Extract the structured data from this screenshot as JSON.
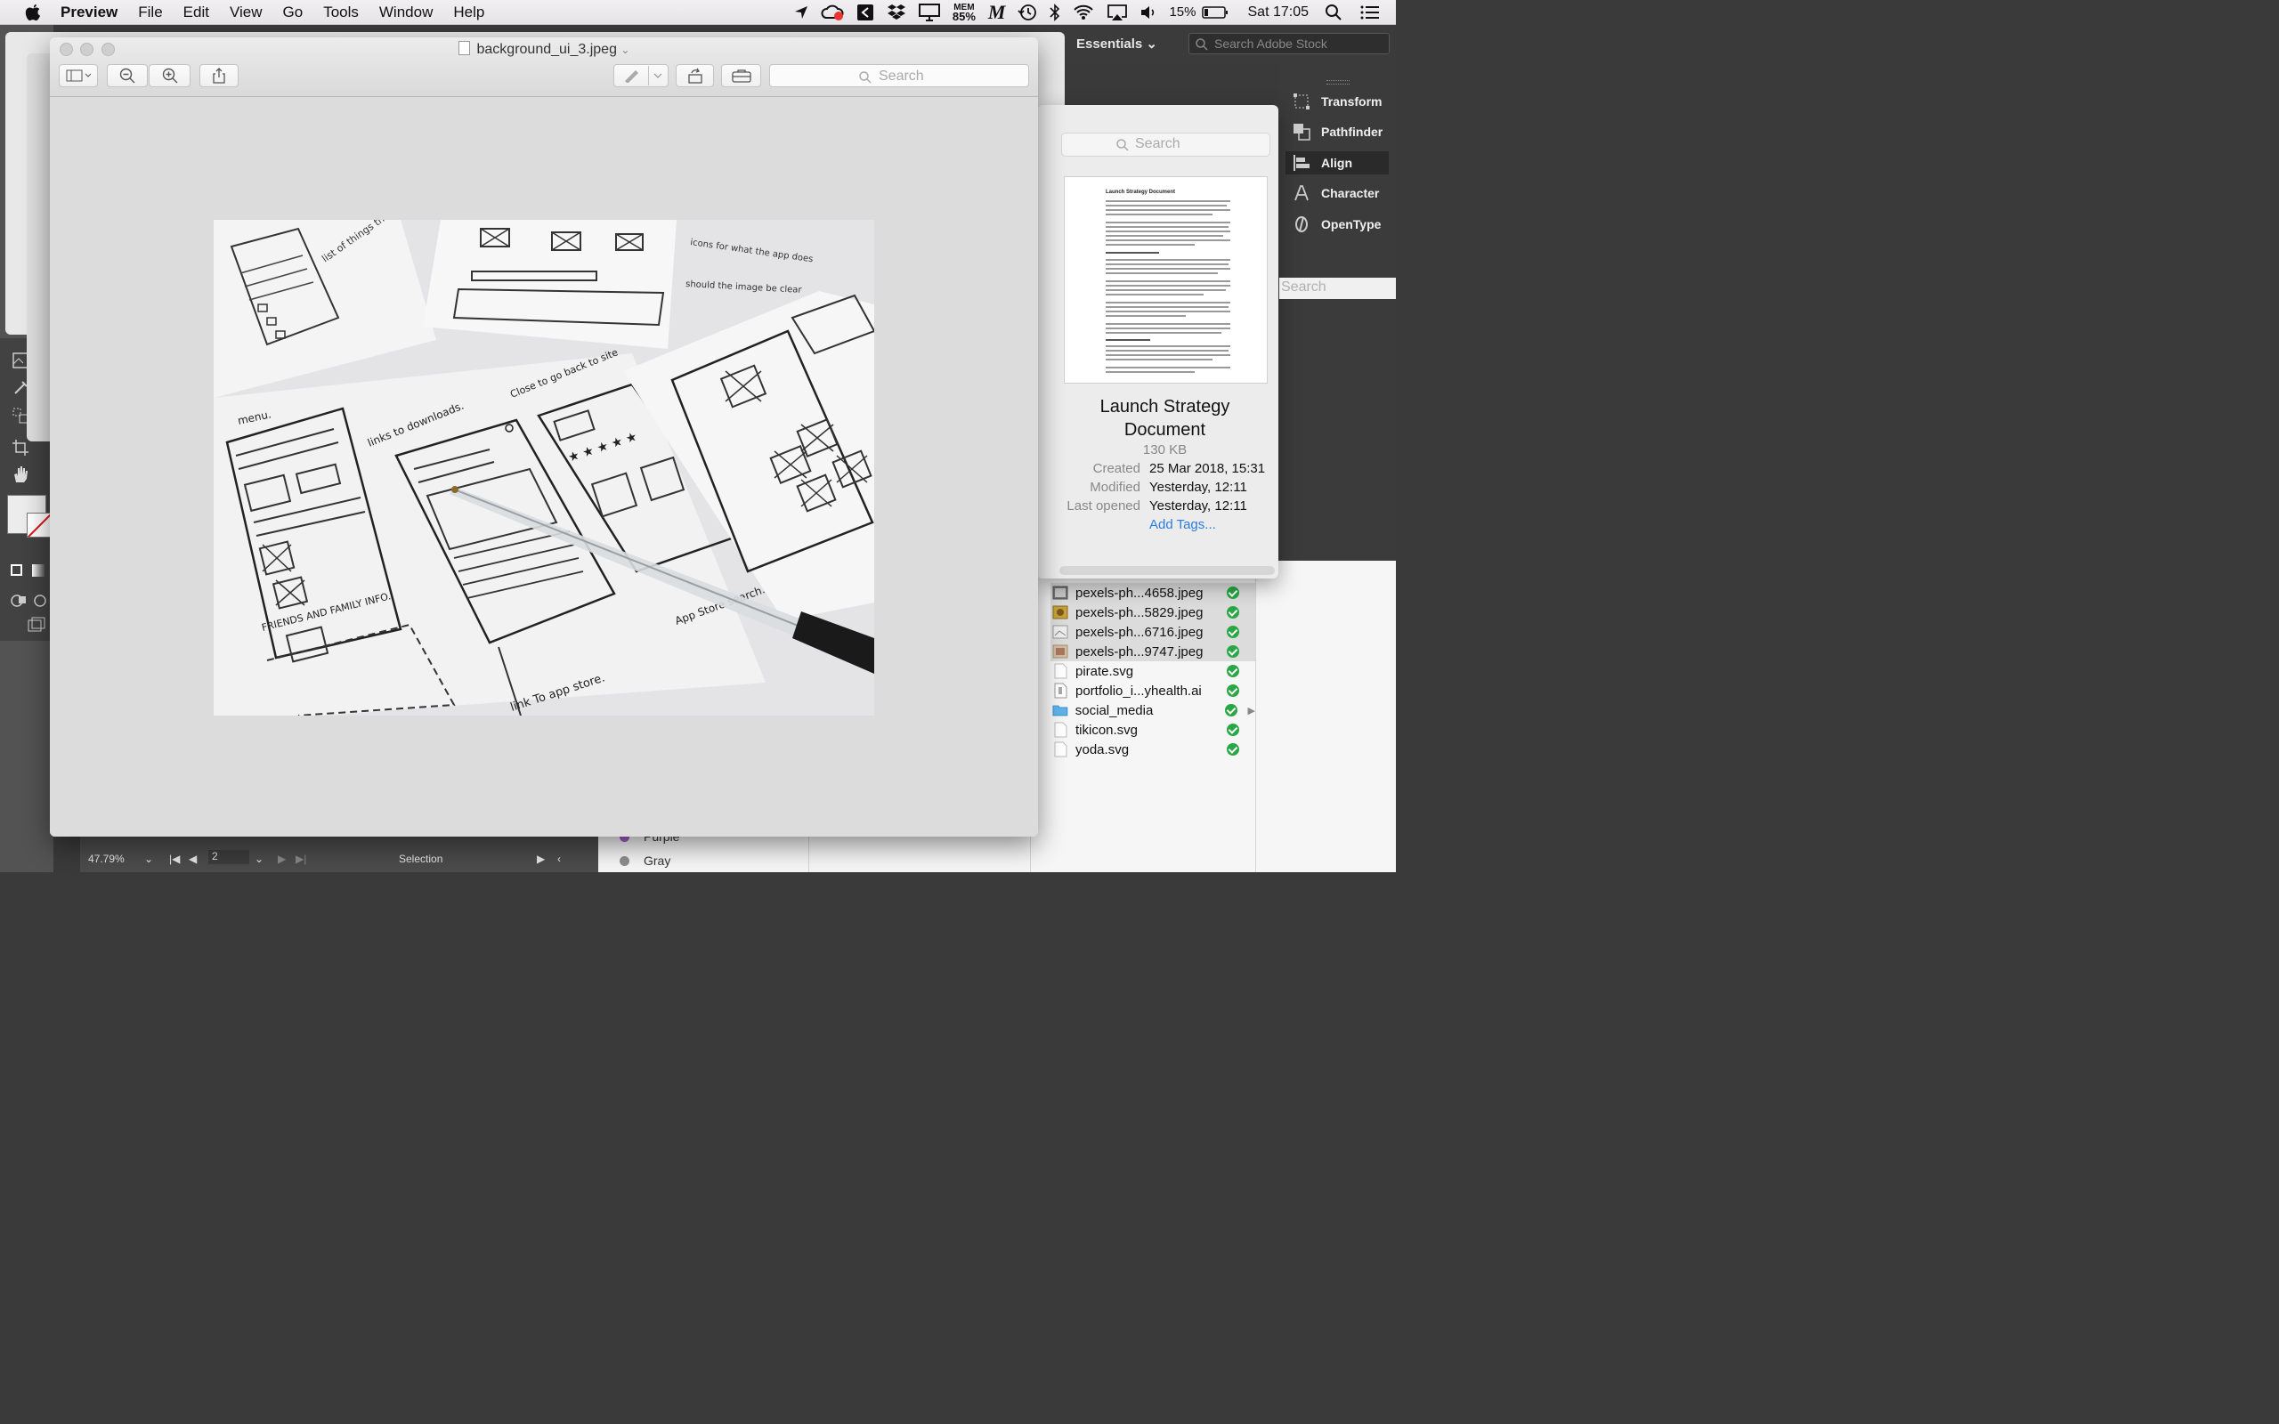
{
  "menubar": {
    "app": "Preview",
    "items": [
      "File",
      "Edit",
      "View",
      "Go",
      "Tools",
      "Window",
      "Help"
    ],
    "mem_label": "MEM",
    "mem_value": "85%",
    "battery": "15%",
    "clock": "Sat 17:05"
  },
  "preview": {
    "title": "background_ui_3.jpeg",
    "search_placeholder": "Search",
    "sketch_notes": {
      "note1": "list of things that the screen is capable of.",
      "note2": "icons for what the app does",
      "note3": "should the image be clear",
      "note4": "menu.",
      "note5": "links to downloads.",
      "note6": "Close to go back to site",
      "note7": "FRIENDS AND FAMILY INFO.",
      "note8": "link To app store.",
      "note9": "App Store search."
    }
  },
  "illustrator": {
    "workspace": "Essentials",
    "stock_search": "Search Adobe Stock",
    "panels": [
      "Transform",
      "Pathfinder",
      "Align",
      "Character",
      "OpenType"
    ],
    "zoom": "47.79%",
    "artboard": "2",
    "status": "Selection",
    "panel_search": "Search"
  },
  "quicklook": {
    "search_placeholder": "Search",
    "thumb_title": "Launch Strategy Document",
    "title": "Launch Strategy Document",
    "size": "130 KB",
    "created_label": "Created",
    "created": "25 Mar 2018, 15:31",
    "modified_label": "Modified",
    "modified": "Yesterday, 12:11",
    "opened_label": "Last opened",
    "opened": "Yesterday, 12:11",
    "add_tags": "Add Tags..."
  },
  "finder": {
    "files": [
      {
        "name": "pexels-ph...4658.jpeg",
        "icon": "image-icon",
        "selected": true
      },
      {
        "name": "pexels-ph...5829.jpeg",
        "icon": "image-icon",
        "selected": true
      },
      {
        "name": "pexels-ph...6716.jpeg",
        "icon": "image-icon",
        "selected": true
      },
      {
        "name": "pexels-ph...9747.jpeg",
        "icon": "image-icon",
        "selected": true
      },
      {
        "name": "pirate.svg",
        "icon": "document-icon",
        "selected": false
      },
      {
        "name": "portfolio_i...yhealth.ai",
        "icon": "document-icon",
        "selected": false
      },
      {
        "name": "social_media",
        "icon": "folder-icon",
        "selected": false
      },
      {
        "name": "tikicon.svg",
        "icon": "document-icon",
        "selected": false
      },
      {
        "name": "yoda.svg",
        "icon": "document-icon",
        "selected": false
      }
    ],
    "tags": [
      {
        "name": "Purple",
        "color": "#a35cc8"
      },
      {
        "name": "Gray",
        "color": "#8e8e8e"
      }
    ]
  }
}
